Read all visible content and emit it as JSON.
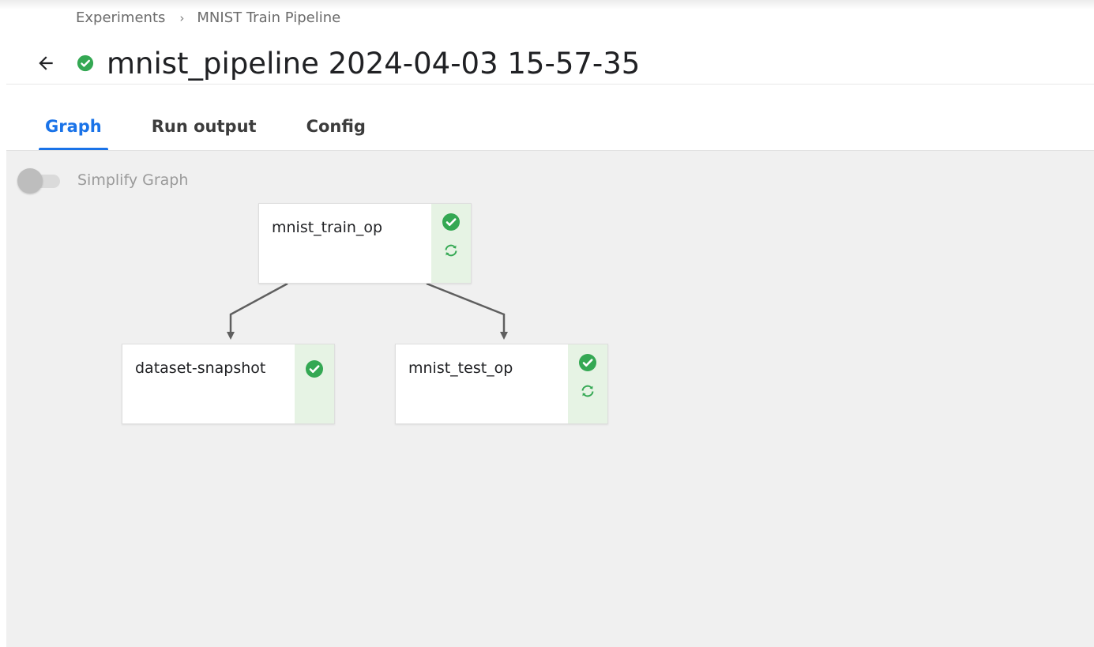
{
  "breadcrumb": {
    "items": [
      "Experiments",
      "MNIST Train Pipeline"
    ],
    "separator": "›"
  },
  "header": {
    "title": "mnist_pipeline 2024-04-03 15-57-35",
    "status": "succeeded",
    "back_icon": "arrow-left-icon",
    "status_icon": "check-circle-icon"
  },
  "tabs": [
    {
      "label": "Graph",
      "active": true
    },
    {
      "label": "Run output",
      "active": false
    },
    {
      "label": "Config",
      "active": false
    }
  ],
  "graph": {
    "simplify_toggle": {
      "label": "Simplify Graph",
      "on": false
    },
    "nodes": [
      {
        "label": "mnist_train_op",
        "status": "succeeded",
        "cached_icon": true
      },
      {
        "label": "dataset-snapshot",
        "status": "succeeded",
        "cached_icon": false
      },
      {
        "label": "mnist_test_op",
        "status": "succeeded",
        "cached_icon": true
      }
    ],
    "edges": [
      {
        "from": "mnist_train_op",
        "to": "dataset-snapshot"
      },
      {
        "from": "mnist_train_op",
        "to": "mnist_test_op"
      }
    ]
  },
  "colors": {
    "accent": "#1a73e8",
    "success": "#34a853",
    "status_strip": "#e6f3e4",
    "canvas": "#f0f0f0",
    "edge": "#5f5f5f"
  }
}
